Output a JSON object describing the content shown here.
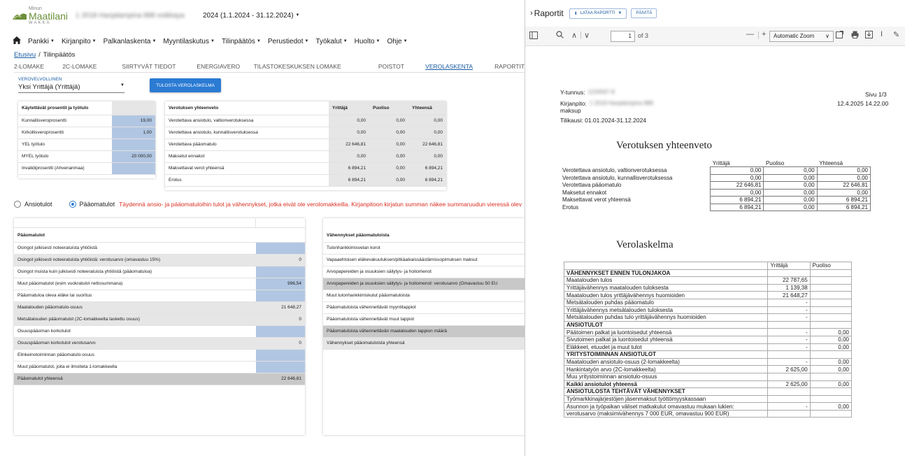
{
  "app": {
    "logo_line1": "Minun",
    "logo_line2": "Maatilani",
    "logo_line3": "WAKKA",
    "company_blurred": "1 2018 Hanjalampina 888 esikkaya",
    "period": "2024 (1.1.2024 - 31.12.2024)",
    "brand_color": "#6b8f3a",
    "accent_color": "#2b7bd3"
  },
  "nav": [
    "Pankki",
    "Kirjanpito",
    "Palkanlaskenta",
    "Myyntilaskutus",
    "Tilinpäätös",
    "Perustiedot",
    "Työkalut",
    "Huolto",
    "Ohje"
  ],
  "breadcrumb": {
    "home": "Etusivu",
    "sep": "/",
    "current": "Tilinpäätös"
  },
  "tabs": [
    "2-LOMAKE",
    "2C-LOMAKE",
    "SIIRTYVÄT TIEDOT",
    "ENERGIAVERO",
    "TILASTOKESKUKSEN LOMAKE",
    "POISTOT",
    "VEROLASKENTA",
    "RAPORTIT"
  ],
  "active_tab": "VEROLASKENTA",
  "verovelvollinen": {
    "label": "VEROVELVOLLINEN",
    "value": "Yksi Yrittäjä (Yrittäjä)"
  },
  "print_button": "TULOSTA VEROLASKELMA",
  "prosentit": {
    "title": "Käytettävät prosentit ja työtulo",
    "rows": [
      {
        "label": "Kunnallisveroprosentti",
        "value": "19,00"
      },
      {
        "label": "Kirkollisveroprosentti",
        "value": "1,00"
      },
      {
        "label": "YEL työtulo",
        "value": ""
      },
      {
        "label": "MYEL työtulo",
        "value": "20 000,00"
      },
      {
        "label": "Invalidiprosentti (Ahvenanmaa)",
        "value": ""
      }
    ]
  },
  "yhteenveto": {
    "headers": [
      "Verotuksen yhteenveto",
      "Yrittäjä",
      "Puoliso",
      "Yhteensä"
    ],
    "rows": [
      [
        "Verotettava ansiotulo, valtionverotuksessa",
        "0,00",
        "0,00",
        "0,00"
      ],
      [
        "Verotettava ansiotulo, kunnallisverotuksessa",
        "0,00",
        "0,00",
        "0,00"
      ],
      [
        "Verotettava pääomatulo",
        "22 646,81",
        "0,00",
        "22 646,81"
      ],
      [
        "Maksetut ennakot",
        "0,00",
        "0,00",
        "0,00"
      ],
      [
        "Maksettavat verot yhteensä",
        "6 894,21",
        "0,00",
        "6 894,21"
      ],
      [
        "Erotus",
        "6 894,21",
        "0,00",
        "6 894,21"
      ]
    ]
  },
  "radio": {
    "option1": "Ansiotulot",
    "option2": "Pääomatulot",
    "selected": "Pääomatulot",
    "warning": "Täydennä ansio- ja pääomatuloihin tulot ja vähennykset, jotka eivät ole verolomakkeilla. Kirjanpitoon kirjatun summan näkee summaruudun vieressä olev"
  },
  "paaomatulot": {
    "title": "Pääomatulot",
    "rows": [
      {
        "label": "Osingot julkisesti noteeratuista yhtiöistä",
        "value": "",
        "style": "white",
        "cell": "blue"
      },
      {
        "label": "Osingot julkisesti noteeratuista yhtiöistä: verotusarvo (omavastuu 15%)",
        "value": "0",
        "style": "grey",
        "cell": "grey"
      },
      {
        "label": "Osingot muista kuin julkisesti noteeratuista yhtiöistä (pääomatuloa)",
        "value": "",
        "style": "white",
        "cell": "blue"
      },
      {
        "label": "Muut pääomatulot (esim vuokratulot nettosummana)",
        "value": "996,54",
        "style": "white",
        "cell": "blue",
        "info": "i"
      },
      {
        "label": "Pääomatuloa oleva eläke tai suoritus",
        "value": "",
        "style": "white",
        "cell": "blue"
      },
      {
        "label": "Maatalouden pääomatulo-osuus",
        "value": "21 648,27",
        "style": "grey",
        "cell": "grey"
      },
      {
        "label": "Metsätalouden pääomatulot (2C-lomakkeelta laskettu osuus)",
        "value": "0",
        "style": "grey",
        "cell": "grey"
      },
      {
        "label": "Osuuspääoman korkotulot",
        "value": "",
        "style": "white",
        "cell": "blue"
      },
      {
        "label": "Osuuspääoman korkotulot verotusarvo",
        "value": "0",
        "style": "grey",
        "cell": "grey"
      },
      {
        "label": "Elinkeinotoiminnan pääomatulo-osuus",
        "value": "",
        "style": "white",
        "cell": "blue"
      },
      {
        "label": "Muut pääomatulot, joita ei ilmoiteta 1-lomakkeella",
        "value": "",
        "style": "white",
        "cell": "blue"
      },
      {
        "label": "Pääomatulot yhteensä",
        "value": "22 646,81",
        "style": "dark",
        "cell": "dark"
      }
    ]
  },
  "vahennykset": {
    "title": "Vähennykset pääomatuloista",
    "rows": [
      {
        "label": "Tulonhankkimisvelan korot",
        "style": "white"
      },
      {
        "label": "Vapaaehtoisen eläkevakuutuksen/pitkäaikaissäästämissopimuksen maksut",
        "style": "white"
      },
      {
        "label": "Arvopapereiden ja osuuksien säilytys- ja hoitomenot",
        "style": "white"
      },
      {
        "label": "Arvopapereiden ja osuuksien säilytys- ja hoitomenot: verotusarvo (Omavastuu 50 EU",
        "style": "grey"
      },
      {
        "label": "Muut tulonhankkimiskulut pääomatuloista",
        "style": "white"
      },
      {
        "label": "Pääomatuloista vähennettävät myyntitappiot",
        "style": "white"
      },
      {
        "label": "Pääomatuloista vähennettävät muut tappiot",
        "style": "white"
      },
      {
        "label": "Pääomatuloista vähennettävän maatalouden tappion määrä",
        "style": "grey"
      },
      {
        "label": "Vähennykset pääomatuloista yhteensä",
        "style": "dark"
      }
    ]
  },
  "pdf": {
    "header_title": "Raportit",
    "download_button": "LATAA RAPORTTI",
    "refresh_button": "PÄIVITÄ",
    "page_current": "1",
    "page_total": "of 3",
    "zoom": "Automatic Zoom",
    "ytunnus_label": "Y-tunnus:",
    "ytunnus_blur": "1234567-8",
    "kirjanpito_label": "Kirjanpito:",
    "kirjanpito_blur": "1 2018 Hanjalampina 888",
    "maksup": "maksup",
    "tilikausi": "Tilikausi: 01.01.2024-31.12.2024",
    "sivu": "Sivu 1/3",
    "date": "12.4.2025 14.22.00",
    "yhteenveto_title": "Verotuksen yhteenveto",
    "yhteenveto_headers": [
      "Yrittäjä",
      "Puoliso",
      "Yhteensä"
    ],
    "yhteenveto_rows": [
      [
        "Verotettava ansiotulo, valtionverotuksessa",
        "0,00",
        "0,00",
        "0,00"
      ],
      [
        "Verotettava ansiotulo, kunnallisverotuksessa",
        "0,00",
        "0,00",
        "0,00"
      ],
      [
        "Verotettava pääomatulo",
        "22 646,81",
        "0,00",
        "22 646,81"
      ],
      [
        "Maksetut ennakot",
        "0,00",
        "0,00",
        "0,00"
      ],
      [
        "Maksettavat verot yhteensä",
        "6 894,21",
        "0,00",
        "6 894,21"
      ],
      [
        "Erotus",
        "6 894,21",
        "0,00",
        "6 894,21"
      ]
    ],
    "verolaskelma_title": "Verolaskelma",
    "verolaskelma_headers": [
      "",
      "Yrittäjä",
      "Puoliso"
    ],
    "verolaskelma_rows": [
      {
        "label": "VÄHENNYKSET ENNEN TULONJAKOA",
        "y": "",
        "p": "",
        "sec": true
      },
      {
        "label": "Maatalouden tulos",
        "y": "22 787,65",
        "p": ""
      },
      {
        "label": "Yrittäjävähennys maatalouden tuloksesta",
        "y": "1 139,38",
        "p": ""
      },
      {
        "label": "Maatalouden tulos yrittäjävähennys huomioiden",
        "y": "21 648,27",
        "p": ""
      },
      {
        "label": "Metsätalouden puhdas pääomatulo",
        "y": "-",
        "p": ""
      },
      {
        "label": "Yrittäjävähennys metsätalouden tuloksesta",
        "y": "-",
        "p": ""
      },
      {
        "label": "Metsätalouden puhdas tulo yrittäjävähennys huomioiden",
        "y": "-",
        "p": ""
      },
      {
        "label": "ANSIOTULOT",
        "y": "",
        "p": "",
        "sec": true
      },
      {
        "label": "Päätoimen palkat ja luontoisedut yhteensä",
        "y": "-",
        "p": "0,00"
      },
      {
        "label": "Sivutoimen palkat ja luontoisedut yhteensä",
        "y": "-",
        "p": "0,00"
      },
      {
        "label": "Eläkkeet, etuudet ja muut tulot",
        "y": "-",
        "p": "0,00"
      },
      {
        "label": "YRITYSTOIMINNAN ANSIOTULOT",
        "y": "",
        "p": "",
        "sec": true
      },
      {
        "label": "Maatalouden ansiotulo-osuus (2-lomakkeelta)",
        "y": "-",
        "p": "0,00"
      },
      {
        "label": "Hankintatyön arvo (2C-lomakkeelta)",
        "y": "2 625,00",
        "p": "0,00"
      },
      {
        "label": "Muu yritystoiminnan ansiotulo-osuus",
        "y": "",
        "p": ""
      },
      {
        "label": "Kaikki ansiotulot yhteensä",
        "y": "2 625,00",
        "p": "0,00",
        "bold": true
      },
      {
        "label": "ANSIOTULOSTA TEHTÄVÄT VÄHENNYKSET",
        "y": "",
        "p": "",
        "sec": true
      },
      {
        "label": "Työmarkkinajärjestöjen jäsenmaksut työttömyyskassaan",
        "y": "",
        "p": ""
      },
      {
        "label": "Asunnon ja työpaikan väliset matkakulut omavastuu mukaan lukien:",
        "y": "-",
        "p": "0,00"
      },
      {
        "label": "verotusarvo (maksimivähennys 7 000 EUR, omavastuu 900 EUR)",
        "y": "",
        "p": ""
      }
    ]
  }
}
